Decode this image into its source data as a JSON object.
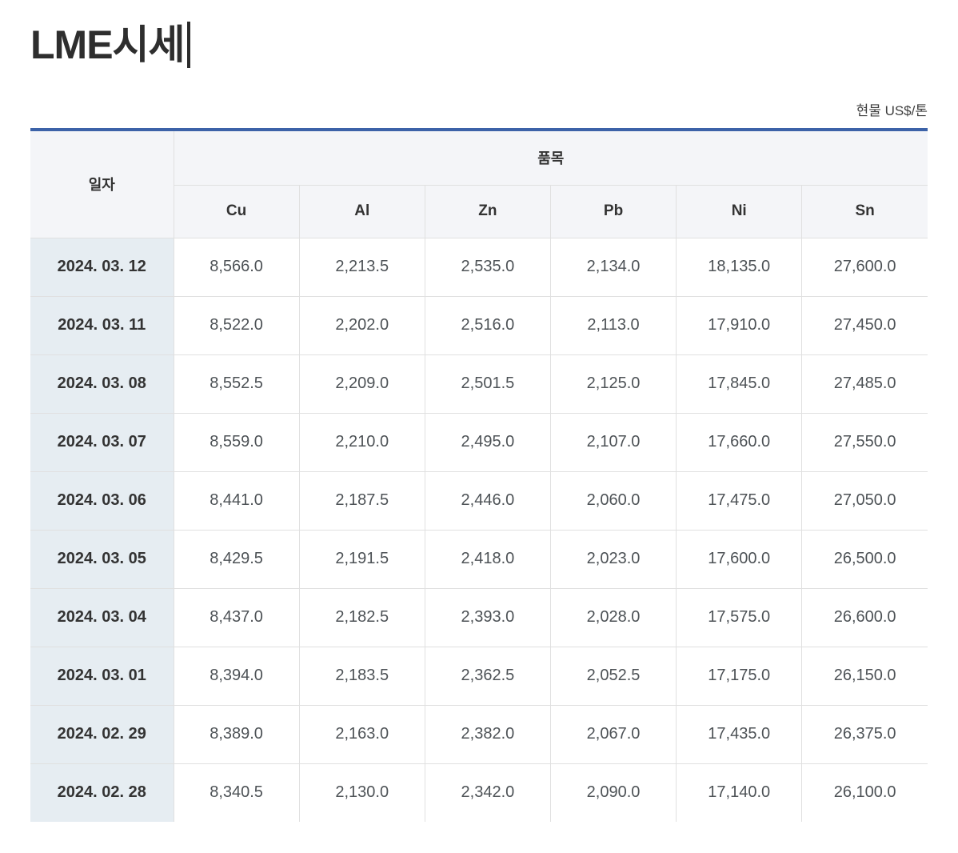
{
  "page": {
    "title": "LME시세",
    "unit_note": "현물 US$/톤"
  },
  "colors": {
    "top_border": "#3c62a8",
    "header_bg": "#f4f5f8",
    "date_col_bg": "#e6edf2",
    "border": "#e0e0e0"
  },
  "table": {
    "date_header": "일자",
    "item_header": "품목",
    "metal_headers": [
      "Cu",
      "Al",
      "Zn",
      "Pb",
      "Ni",
      "Sn"
    ],
    "rows": [
      {
        "date": "2024. 03. 12",
        "values": [
          "8,566.0",
          "2,213.5",
          "2,535.0",
          "2,134.0",
          "18,135.0",
          "27,600.0"
        ]
      },
      {
        "date": "2024. 03. 11",
        "values": [
          "8,522.0",
          "2,202.0",
          "2,516.0",
          "2,113.0",
          "17,910.0",
          "27,450.0"
        ]
      },
      {
        "date": "2024. 03. 08",
        "values": [
          "8,552.5",
          "2,209.0",
          "2,501.5",
          "2,125.0",
          "17,845.0",
          "27,485.0"
        ]
      },
      {
        "date": "2024. 03. 07",
        "values": [
          "8,559.0",
          "2,210.0",
          "2,495.0",
          "2,107.0",
          "17,660.0",
          "27,550.0"
        ]
      },
      {
        "date": "2024. 03. 06",
        "values": [
          "8,441.0",
          "2,187.5",
          "2,446.0",
          "2,060.0",
          "17,475.0",
          "27,050.0"
        ]
      },
      {
        "date": "2024. 03. 05",
        "values": [
          "8,429.5",
          "2,191.5",
          "2,418.0",
          "2,023.0",
          "17,600.0",
          "26,500.0"
        ]
      },
      {
        "date": "2024. 03. 04",
        "values": [
          "8,437.0",
          "2,182.5",
          "2,393.0",
          "2,028.0",
          "17,575.0",
          "26,600.0"
        ]
      },
      {
        "date": "2024. 03. 01",
        "values": [
          "8,394.0",
          "2,183.5",
          "2,362.5",
          "2,052.5",
          "17,175.0",
          "26,150.0"
        ]
      },
      {
        "date": "2024. 02. 29",
        "values": [
          "8,389.0",
          "2,163.0",
          "2,382.0",
          "2,067.0",
          "17,435.0",
          "26,375.0"
        ]
      },
      {
        "date": "2024. 02. 28",
        "values": [
          "8,340.5",
          "2,130.0",
          "2,342.0",
          "2,090.0",
          "17,140.0",
          "26,100.0"
        ]
      }
    ]
  }
}
